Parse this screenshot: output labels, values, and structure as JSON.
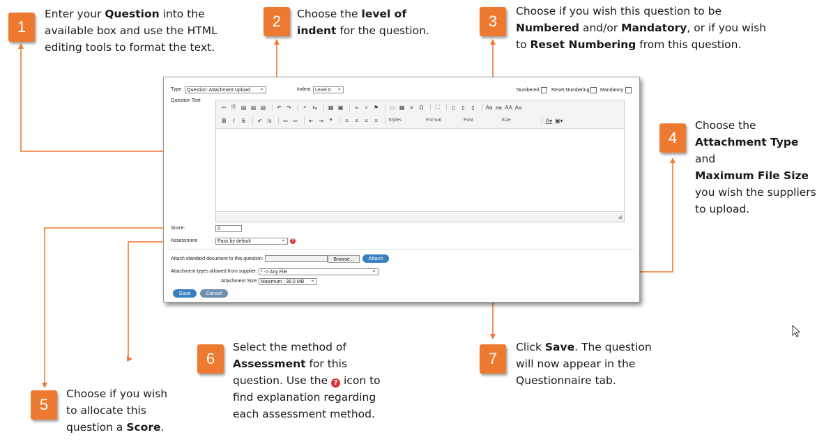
{
  "callouts": [
    {
      "num": "1",
      "lines": [
        [
          {
            "t": "Enter your "
          },
          {
            "t": "Question",
            "b": true
          },
          {
            "t": " into the"
          }
        ],
        [
          {
            "t": "available box and use the HTML"
          }
        ],
        [
          {
            "t": "editing tools to format the text."
          }
        ]
      ]
    },
    {
      "num": "2",
      "lines": [
        [
          {
            "t": "Choose the "
          },
          {
            "t": "level of",
            "b": true
          }
        ],
        [
          {
            "t": "indent",
            "b": true
          },
          {
            "t": " for the question."
          }
        ]
      ]
    },
    {
      "num": "3",
      "lines": [
        [
          {
            "t": "Choose if you wish this question to be"
          }
        ],
        [
          {
            "t": "Numbered",
            "b": true
          },
          {
            "t": " and/or "
          },
          {
            "t": "Mandatory",
            "b": true
          },
          {
            "t": ", or if you wish"
          }
        ],
        [
          {
            "t": "to "
          },
          {
            "t": "Reset Numbering",
            "b": true
          },
          {
            "t": " from this question."
          }
        ]
      ]
    },
    {
      "num": "4",
      "lines": [
        [
          {
            "t": "Choose the"
          }
        ],
        [
          {
            "t": "Attachment Type",
            "b": true
          },
          {
            "t": " and"
          }
        ],
        [
          {
            "t": "Maximum File Size",
            "b": true
          }
        ],
        [
          {
            "t": "you wish the suppliers"
          }
        ],
        [
          {
            "t": "to upload."
          }
        ]
      ]
    },
    {
      "num": "5",
      "lines": [
        [
          {
            "t": "Choose if you wish"
          }
        ],
        [
          {
            "t": "to allocate this"
          }
        ],
        [
          {
            "t": "question a "
          },
          {
            "t": "Score",
            "b": true
          },
          {
            "t": "."
          }
        ]
      ]
    },
    {
      "num": "6",
      "lines": [
        [
          {
            "t": "Select the method of"
          }
        ],
        [
          {
            "t": "Assessment",
            "b": true
          },
          {
            "t": " for this"
          }
        ],
        [
          {
            "t": "question. Use the "
          },
          {
            "t": "❓",
            "icon": "help-icon"
          },
          {
            "t": " icon to"
          }
        ],
        [
          {
            "t": "find explanation regarding"
          }
        ],
        [
          {
            "t": "each assessment method."
          }
        ]
      ]
    },
    {
      "num": "7",
      "lines": [
        [
          {
            "t": "Click "
          },
          {
            "t": "Save",
            "b": true
          },
          {
            "t": ". The question"
          }
        ],
        [
          {
            "t": "will now appear in the"
          }
        ],
        [
          {
            "t": "Questionnaire tab."
          }
        ]
      ]
    }
  ],
  "form": {
    "type_label": "Type",
    "type_value": "Question: Attachment Upload",
    "indent_label": "Indent",
    "indent_value": "Level 0",
    "numbered_label": "Numbered",
    "reset_numbering_label": "Reset Numbering",
    "mandatory_label": "Mandatory",
    "question_text_label": "Question Text",
    "styles_label": "Styles",
    "format_label": "Format",
    "font_label": "Font",
    "size_label": "Size",
    "score_label": "Score:",
    "score_value": "0",
    "assessment_label": "Assessment",
    "assessment_value": "Pass by default",
    "attach_doc_label": "Attach standard document to this question:",
    "browse_label": "Browse...",
    "attach_label": "Attach",
    "attachment_types_label": "Attachment types allowed from supplier:",
    "attachment_types_value": "* -> Any File",
    "attachment_size_label": "Attachment Size:",
    "attachment_size_value": "Maximum : 38.0 MB",
    "save_label": "Save",
    "cancel_label": "Cancel"
  },
  "colors": {
    "accent": "#ee7a31",
    "button_blue": "#3a7fc0",
    "help_red": "#d33333"
  }
}
